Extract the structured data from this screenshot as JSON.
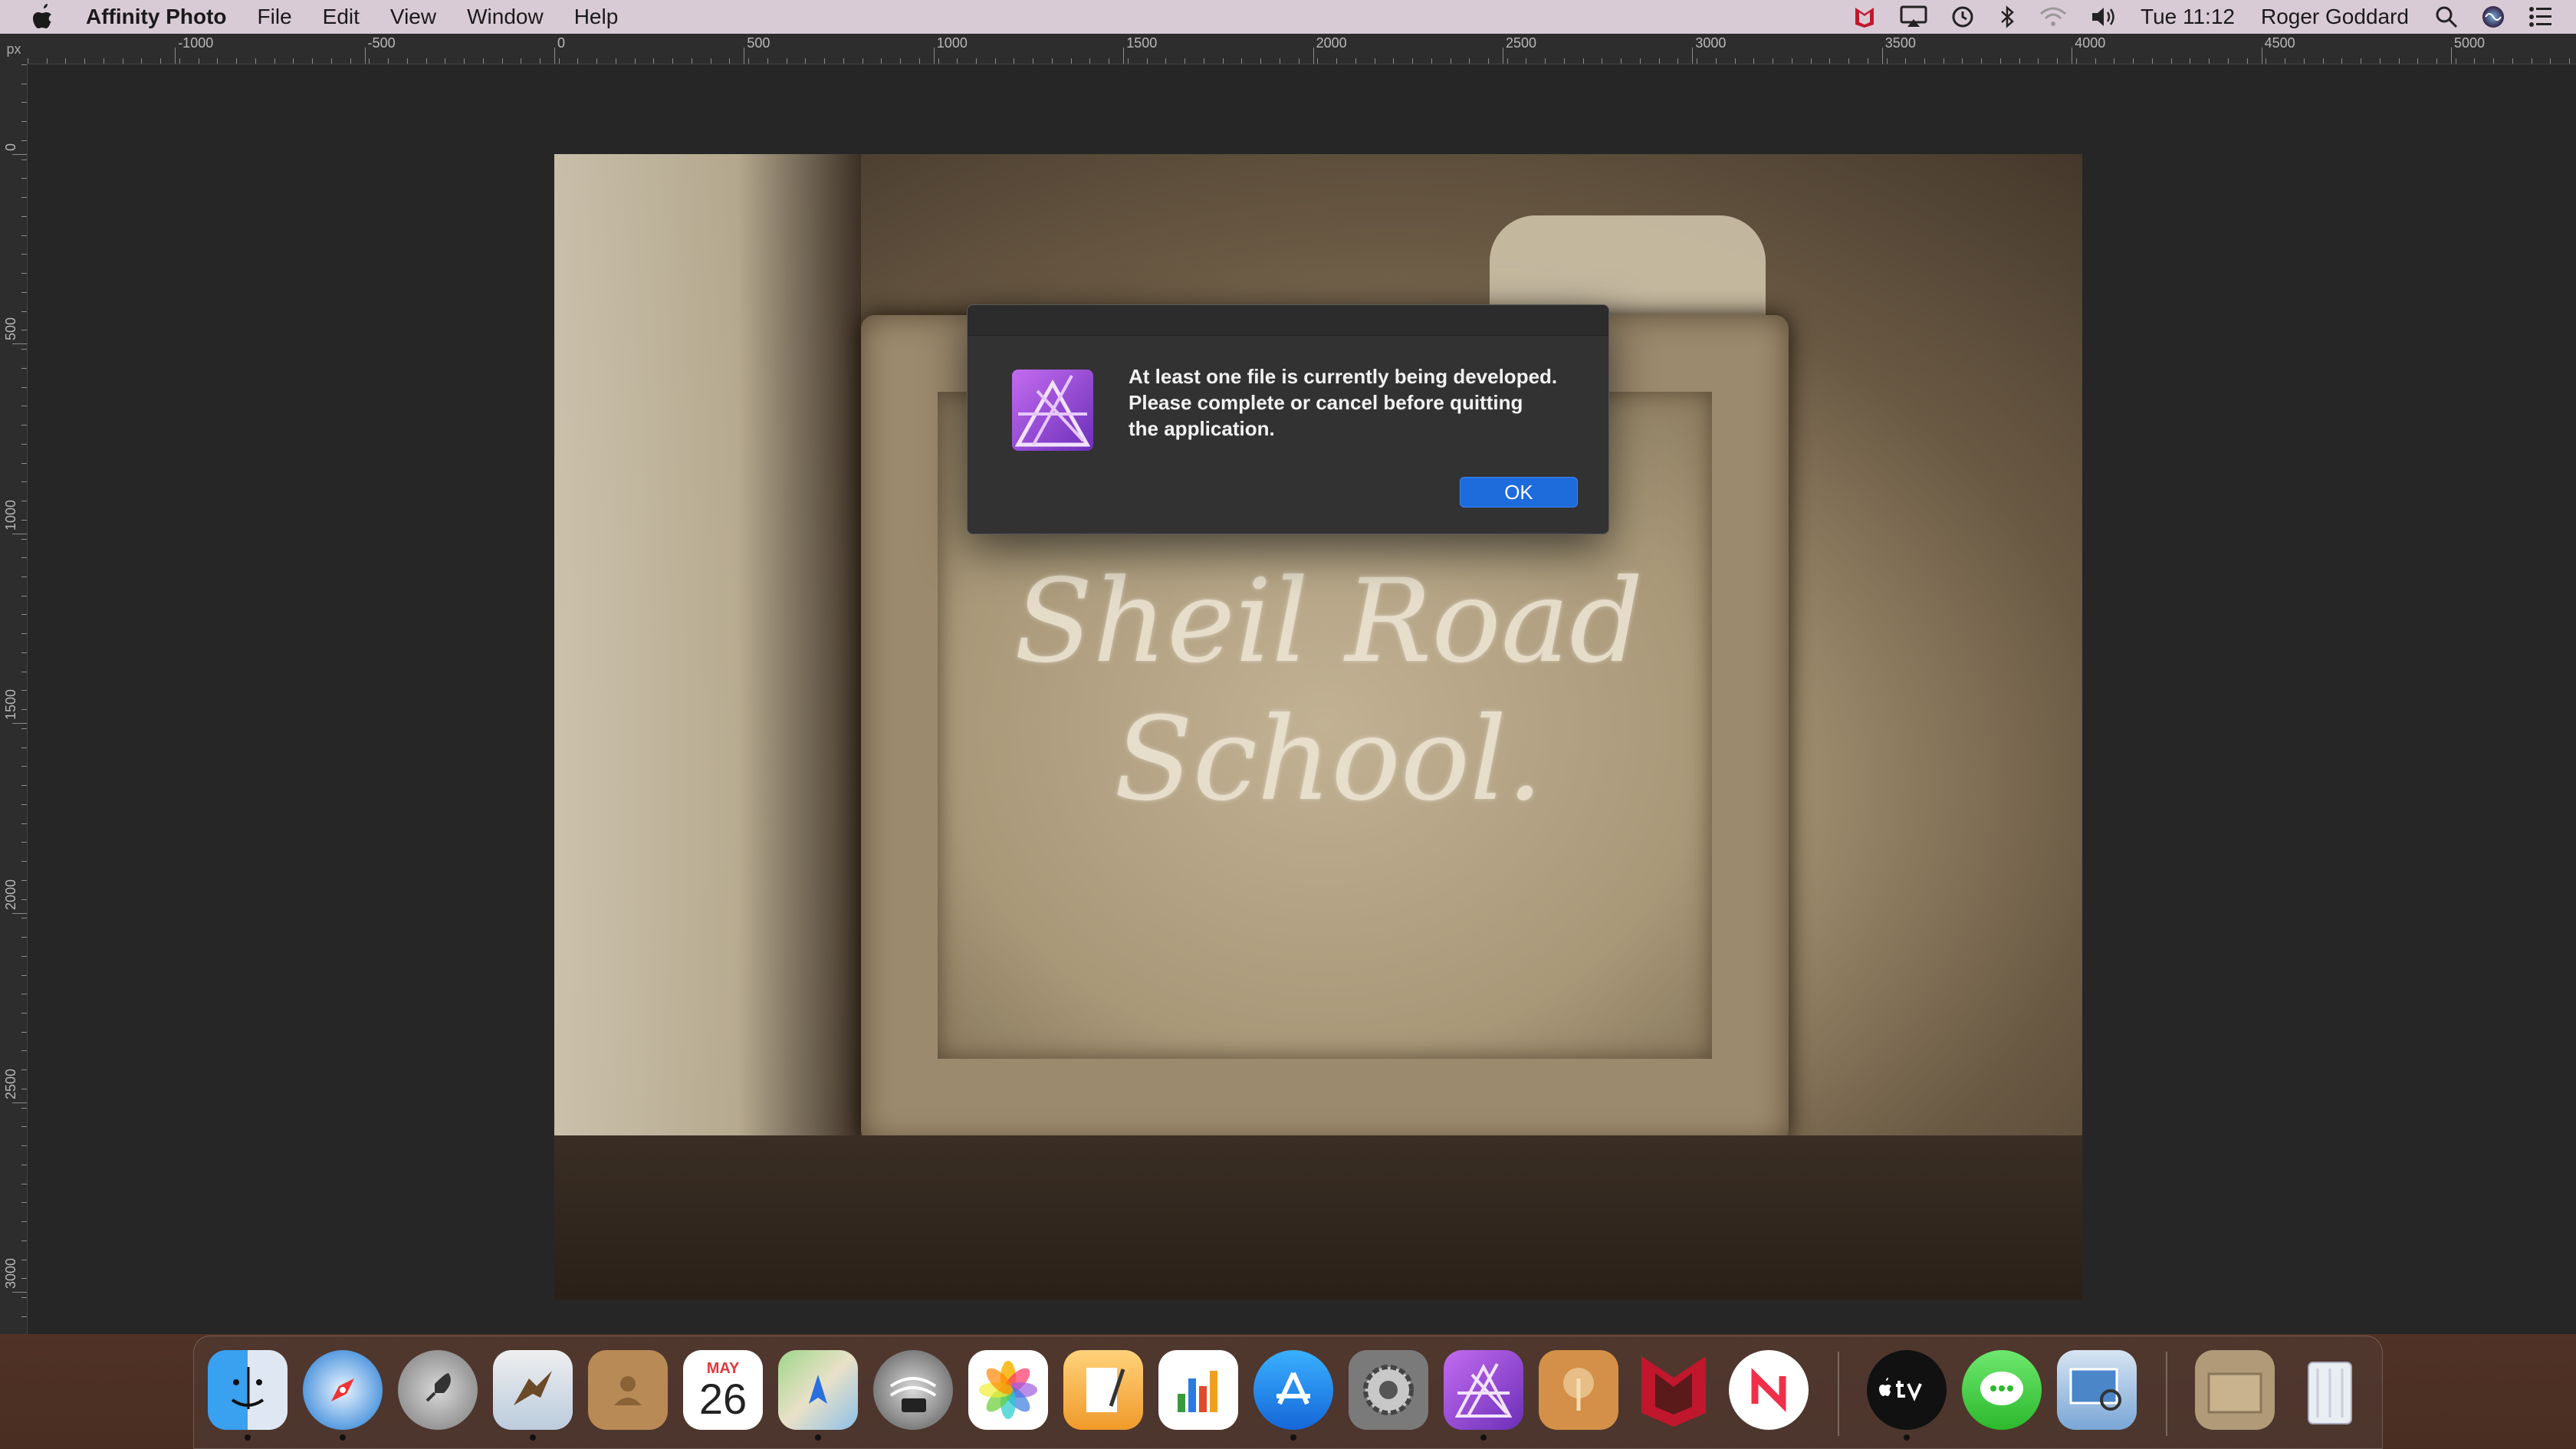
{
  "menubar": {
    "app_name": "Affinity Photo",
    "menus": [
      "File",
      "Edit",
      "View",
      "Window",
      "Help"
    ],
    "clock": "Tue 11:12",
    "user": "Roger Goddard"
  },
  "ruler": {
    "unit": "px",
    "top_labels": [
      "-1000",
      "-500",
      "0",
      "500",
      "1000",
      "1500",
      "2000",
      "2500",
      "3000",
      "3500",
      "4000",
      "4500",
      "5000"
    ],
    "left_labels": [
      "0",
      "500",
      "1000",
      "1500",
      "2000",
      "2500",
      "3000"
    ]
  },
  "canvas": {
    "chalk_text": "Sheil Road School."
  },
  "dialog": {
    "message": "At least one file is currently being developed. Please complete or cancel before quitting the application.",
    "ok_label": "OK"
  },
  "dock": {
    "calendar_month": "MAY",
    "calendar_day": "26",
    "items": [
      "finder-icon",
      "safari-icon",
      "launchpad-icon",
      "mail-icon",
      "contacts-icon",
      "calendar-icon",
      "maps-icon",
      "google-earth-pro-icon",
      "photos-icon",
      "pages-icon",
      "numbers-icon",
      "app-store-icon",
      "system-preferences-icon",
      "affinity-photo-icon",
      "macfamilytree-icon",
      "mcafee-icon",
      "news-icon",
      "apple-tv-icon",
      "messages-icon",
      "preview-icon",
      "downloads-stack-icon",
      "trash-icon"
    ]
  },
  "colors": {
    "accent_blue": "#1e6bdc",
    "affinity_purple": "#9b4fe0",
    "menubar_bg": "#d9cbd6"
  }
}
